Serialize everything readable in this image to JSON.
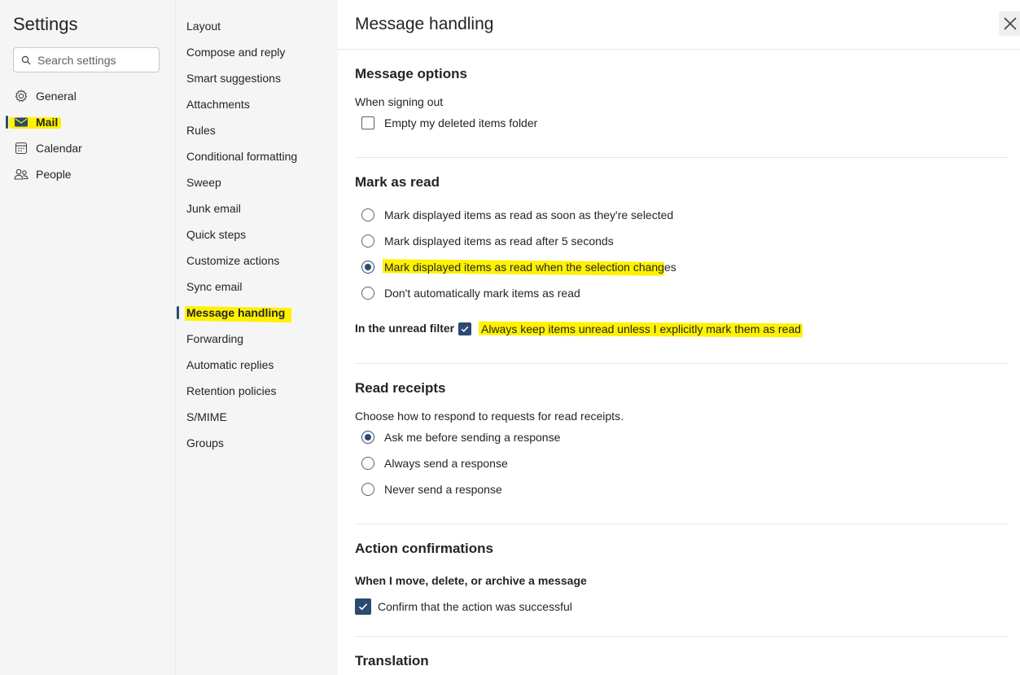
{
  "left": {
    "title": "Settings",
    "search_placeholder": "Search settings",
    "categories": [
      {
        "label": "General",
        "icon": "gear-icon"
      },
      {
        "label": "Mail",
        "icon": "mail-icon"
      },
      {
        "label": "Calendar",
        "icon": "calendar-icon"
      },
      {
        "label": "People",
        "icon": "people-icon"
      }
    ]
  },
  "sub": {
    "items": [
      "Layout",
      "Compose and reply",
      "Smart suggestions",
      "Attachments",
      "Rules",
      "Conditional formatting",
      "Sweep",
      "Junk email",
      "Quick steps",
      "Customize actions",
      "Sync email",
      "Message handling",
      "Forwarding",
      "Automatic replies",
      "Retention policies",
      "S/MIME",
      "Groups"
    ]
  },
  "main": {
    "title": "Message handling",
    "message_options": {
      "title": "Message options",
      "when_signing_out": "When signing out",
      "empty_deleted": "Empty my deleted items folder"
    },
    "mark_as_read": {
      "title": "Mark as read",
      "options": [
        "Mark displayed items as read as soon as they're selected",
        "Mark displayed items as read after 5 seconds",
        "Mark displayed items as read when the selection changes",
        "Don't automatically mark items as read"
      ],
      "unread_filter_label": "In the unread filter",
      "unread_filter_option": "Always keep items unread unless I explicitly mark them as read"
    },
    "read_receipts": {
      "title": "Read receipts",
      "description": "Choose how to respond to requests for read receipts.",
      "options": [
        "Ask me before sending a response",
        "Always send a response",
        "Never send a response"
      ]
    },
    "action_confirmations": {
      "title": "Action confirmations",
      "subtitle": "When I move, delete, or archive a message",
      "option": "Confirm that the action was successful"
    },
    "translation": {
      "title": "Translation"
    }
  },
  "colors": {
    "accent": "#2b4a6f",
    "highlight": "#fff200",
    "sidebar_bg": "#f5f5f5"
  }
}
